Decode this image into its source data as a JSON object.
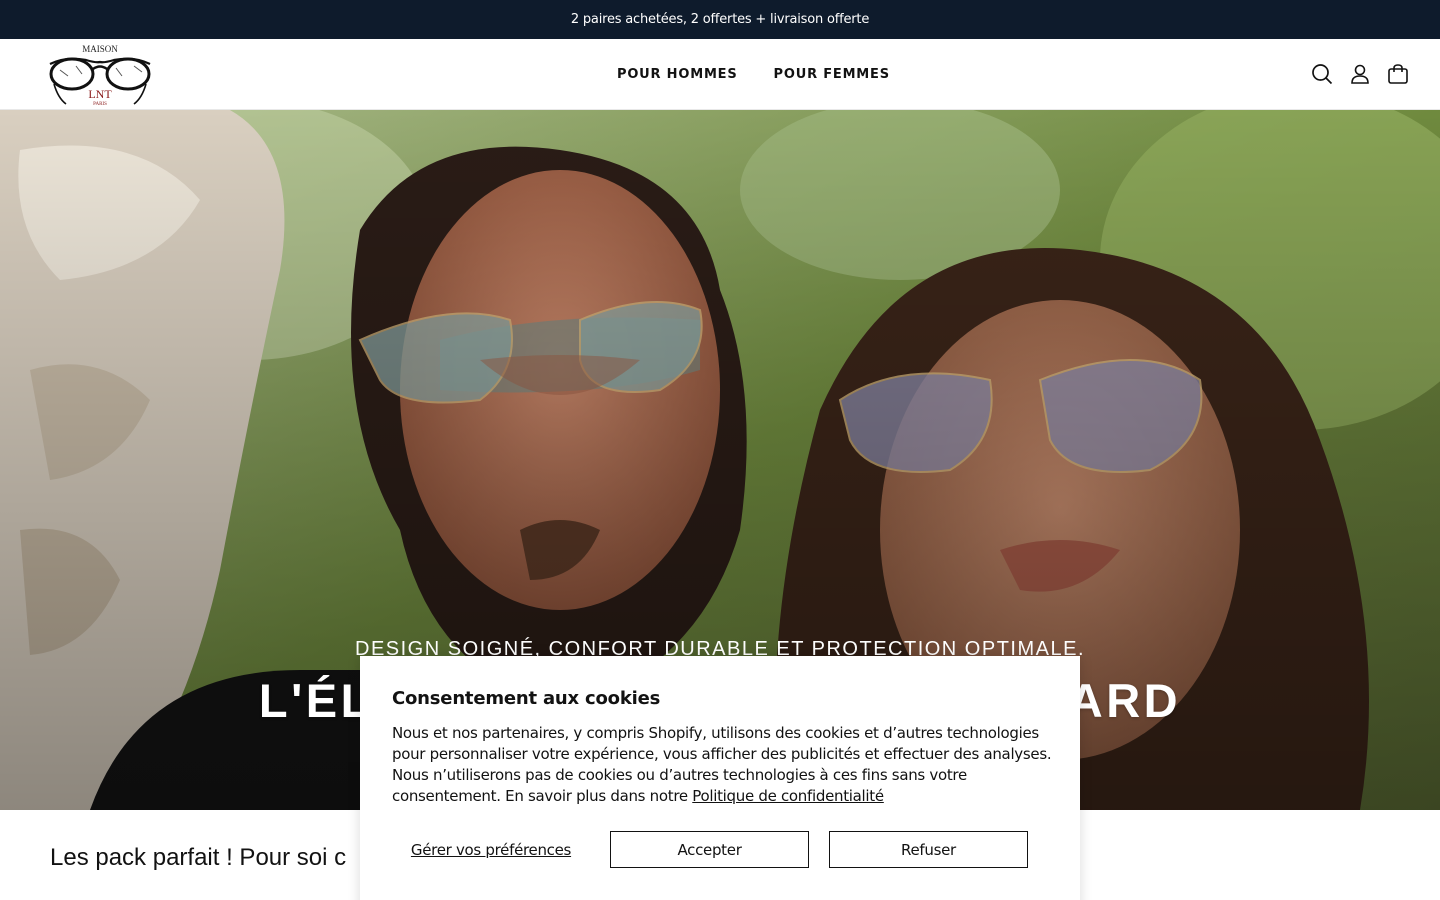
{
  "announcement": "2 paires achetées, 2 offertes + livraison offerte",
  "header": {
    "logo": {
      "top": "MAISON",
      "mark": "LNT",
      "bottom": "PARIS"
    },
    "nav": [
      {
        "label": "POUR HOMMES"
      },
      {
        "label": "POUR FEMMES"
      }
    ],
    "icons": [
      "search-icon",
      "account-icon",
      "cart-icon"
    ]
  },
  "hero": {
    "title": "L'ÉLÉGANCE AU PREMIER REGARD",
    "subtitle": "DESIGN SOIGNÉ, CONFORT DURABLE ET PROTECTION OPTIMALE."
  },
  "section": {
    "heading": "Les pack parfait ! Pour soi c"
  },
  "cookie": {
    "title": "Consentement aux cookies",
    "text": "Nous et nos partenaires, y compris Shopify, utilisons des cookies et d’autres technologies pour personnaliser votre expérience, vous afficher des publicités et effectuer des analyses. Nous n’utiliserons pas de cookies ou d’autres technologies à ces fins sans votre consentement. En savoir plus dans notre ",
    "policy_link": "Politique de confidentialité",
    "manage_label": "Gérer vos préférences",
    "accept_label": "Accepter",
    "decline_label": "Refuser"
  },
  "colors": {
    "announcement_bg": "#0e1b2c",
    "text": "#121212"
  }
}
